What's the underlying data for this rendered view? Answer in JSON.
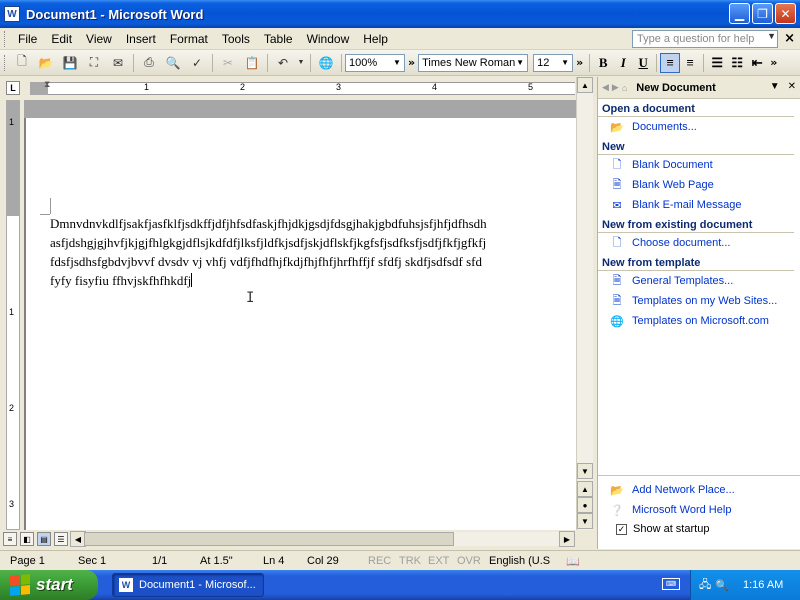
{
  "window": {
    "title": "Document1 - Microsoft Word",
    "app_icon": "W"
  },
  "menubar": {
    "items": [
      "File",
      "Edit",
      "View",
      "Insert",
      "Format",
      "Tools",
      "Table",
      "Window",
      "Help"
    ],
    "help_placeholder": "Type a question for help"
  },
  "toolbar": {
    "zoom": "100%",
    "font": "Times New Roman",
    "font_size": "12",
    "bold": "B",
    "italic": "I",
    "underline": "U"
  },
  "ruler": {
    "numbers": [
      "1",
      "2",
      "3",
      "4",
      "5"
    ]
  },
  "vruler": {
    "numbers": [
      "1",
      "1",
      "2",
      "3"
    ]
  },
  "document": {
    "lines": [
      "Dmnvdnvkdlfjsakfjasfklfjsdkffjdfjhfsdfaskjfhjdkjgsdjfdsgjhakjgbdfuhsjsfjhfjdfhsdh",
      "asfjdshgjgjhvfjkjgjfhlgkgjdflsjkdfdfjlksfjldfkjsdfjskjdflskfjkgfsfjsdfksfjsdfjfkfjgfkfj",
      "fdsfjsdhsfgbdvjbvvf dvsdv vj vhfj vdfjfhdfhjfkdjfhjfhfjhrfhffjf sfdfj skdfjsdfsdf sfd",
      "fyfy fisyfiu ffhvjskfhfhkdfj"
    ]
  },
  "statusbar": {
    "page": "Page 1",
    "sec": "Sec 1",
    "pages": "1/1",
    "at": "At 1.5\"",
    "ln": "Ln 4",
    "col": "Col 29",
    "rec": "REC",
    "trk": "TRK",
    "ext": "EXT",
    "ovr": "OVR",
    "lang": "English (U.S"
  },
  "taskpane": {
    "title": "New Document",
    "open_heading": "Open a document",
    "open_links": [
      "Documents..."
    ],
    "new_heading": "New",
    "new_links": [
      "Blank Document",
      "Blank Web Page",
      "Blank E-mail Message"
    ],
    "existing_heading": "New from existing document",
    "existing_links": [
      "Choose document..."
    ],
    "template_heading": "New from template",
    "template_links": [
      "General Templates...",
      "Templates on my Web Sites...",
      "Templates on Microsoft.com"
    ],
    "bottom_links": [
      "Add Network Place...",
      "Microsoft Word Help"
    ],
    "show_at_startup": "Show at startup"
  },
  "taskbar": {
    "start": "start",
    "task": "Document1 - Microsof...",
    "clock": "1:16 AM"
  },
  "colors": {
    "titlebar": "#0554d4",
    "taskbar": "#245edb",
    "start": "#3a9a33",
    "link": "#0033cc"
  }
}
